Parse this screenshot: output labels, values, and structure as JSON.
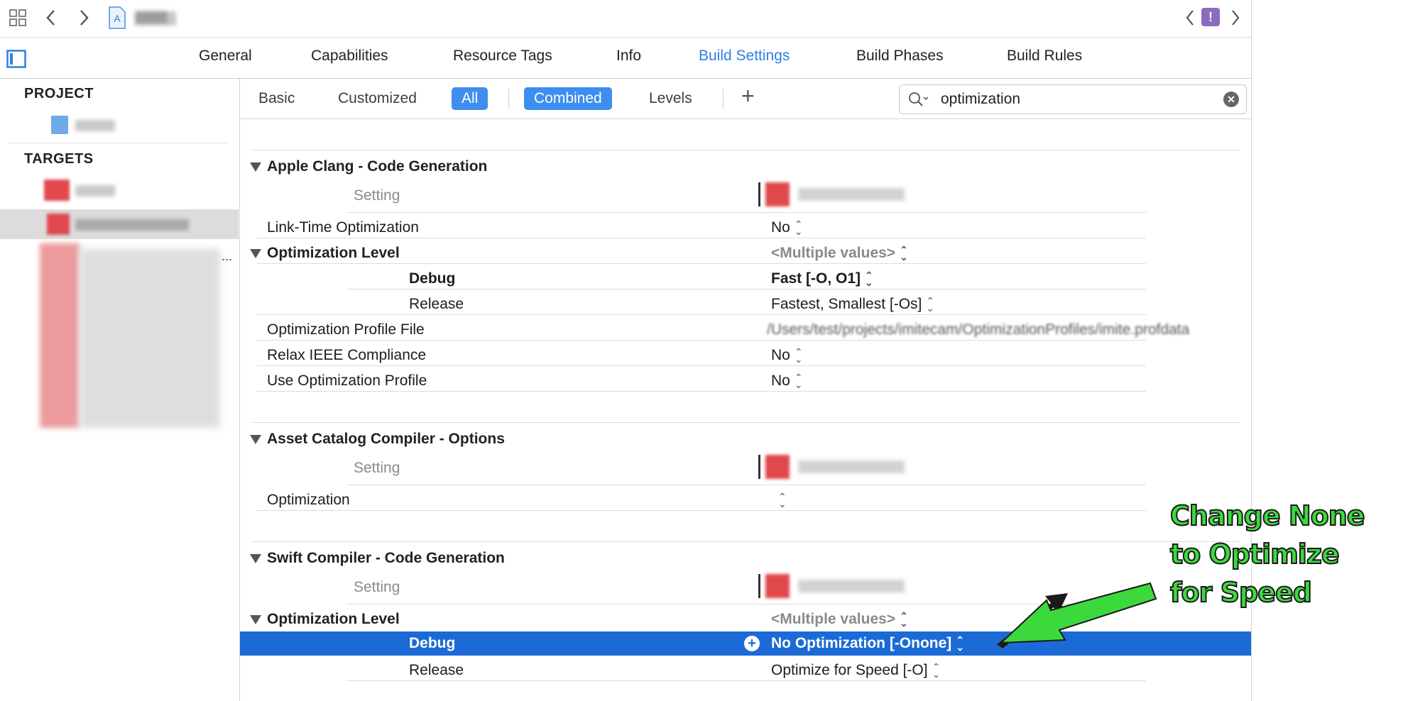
{
  "toolbar": {
    "project_name": "▒▒▒▒",
    "icons": [
      "grid-icon",
      "back-chevron-icon",
      "forward-chevron-icon",
      "app-project-icon",
      "issue-back-icon",
      "warning-badge-icon",
      "issue-forward-icon"
    ]
  },
  "tabs": [
    "General",
    "Capabilities",
    "Resource Tags",
    "Info",
    "Build Settings",
    "Build Phases",
    "Build Rules"
  ],
  "active_tab": "Build Settings",
  "sidebar": {
    "project_header": "PROJECT",
    "targets_header": "TARGETS",
    "truncation": "..."
  },
  "filters": {
    "basic": "Basic",
    "customized": "Customized",
    "all": "All",
    "combined": "Combined",
    "levels": "Levels",
    "add": "+"
  },
  "search": {
    "value": "optimization",
    "clear_icon": "clear-icon"
  },
  "sections": {
    "clang": {
      "title": "Apple Clang - Code Generation",
      "setting_label": "Setting",
      "rows": {
        "lto": {
          "name": "Link-Time Optimization",
          "value": "No"
        },
        "opt_level": {
          "name": "Optimization Level",
          "value": "<Multiple values>"
        },
        "debug": {
          "name": "Debug",
          "value": "Fast [-O, O1]"
        },
        "release": {
          "name": "Release",
          "value": "Fastest, Smallest [-Os]"
        },
        "profile_file": {
          "name": "Optimization Profile File",
          "value": "/Users/test/projects/imitecam/OptimizationProfiles/imite.profdata"
        },
        "ieee": {
          "name": "Relax IEEE Compliance",
          "value": "No"
        },
        "use_profile": {
          "name": "Use Optimization Profile",
          "value": "No"
        }
      }
    },
    "asset": {
      "title": "Asset Catalog Compiler - Options",
      "setting_label": "Setting",
      "rows": {
        "optimization": {
          "name": "Optimization",
          "value": ""
        }
      }
    },
    "swift": {
      "title": "Swift Compiler - Code Generation",
      "setting_label": "Setting",
      "rows": {
        "opt_level": {
          "name": "Optimization Level",
          "value": "<Multiple values>"
        },
        "debug": {
          "name": "Debug",
          "value": "No Optimization [-Onone]"
        },
        "release": {
          "name": "Release",
          "value": "Optimize for Speed [-O]"
        }
      }
    }
  },
  "annotation": {
    "line1": "Change None",
    "line2": "to Optimize",
    "line3": "for Speed",
    "color": "#3cd93c"
  },
  "colors": {
    "accent": "#2f7fe0",
    "selection": "#1b6ad6",
    "filter_on": "#3d8ef0"
  }
}
